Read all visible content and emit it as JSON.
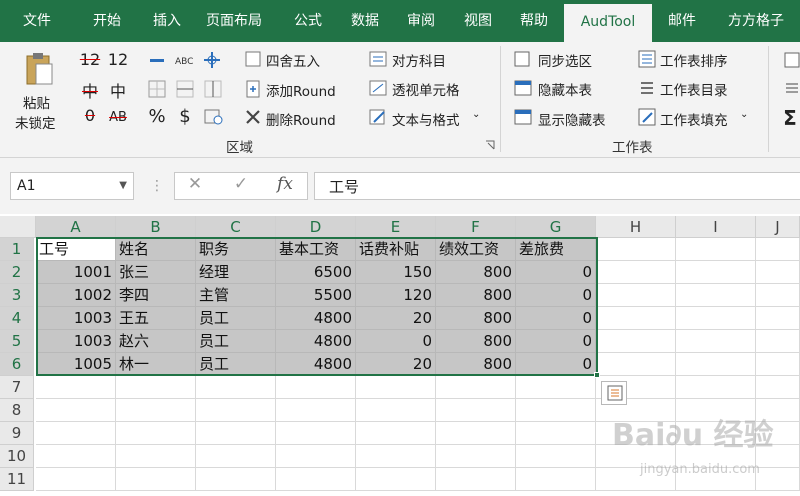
{
  "ribbon_tabs": [
    {
      "label": "文件",
      "active": false
    },
    {
      "label": "开始",
      "active": false
    },
    {
      "label": "插入",
      "active": false
    },
    {
      "label": "页面布局",
      "active": false
    },
    {
      "label": "公式",
      "active": false
    },
    {
      "label": "数据",
      "active": false
    },
    {
      "label": "审阅",
      "active": false
    },
    {
      "label": "视图",
      "active": false
    },
    {
      "label": "帮助",
      "active": false
    },
    {
      "label": "AudTool",
      "active": true
    },
    {
      "label": "邮件",
      "active": false
    },
    {
      "label": "方方格子",
      "active": false
    }
  ],
  "ribbon": {
    "paste_unlocked_line1": "粘贴",
    "paste_unlocked_line2": "未锁定",
    "num_buttons": [
      "12",
      "12",
      "中",
      "中",
      "0",
      "AB"
    ],
    "format_glyphs": {
      "percent": "%",
      "dollar": "$"
    },
    "round_half_up": "四舍五入",
    "add_round": "添加Round",
    "remove_round": "删除Round",
    "group_area": "区域",
    "match_accounts": "对方科目",
    "pivot_cells": "透视单元格",
    "text_and_format": "文本与格式",
    "sync_selection": "同步选区",
    "hide_sheet": "隐藏本表",
    "show_hidden_sheets": "显示隐藏表",
    "sort_sheets": "工作表排序",
    "sheet_index": "工作表目录",
    "fill_sheets": "工作表填充",
    "group_sheet": "工作表",
    "sigma": "Σ"
  },
  "formula_bar": {
    "name_box": "A1",
    "cancel_glyph": "✕",
    "confirm_glyph": "✓",
    "fx": "fx",
    "content": "工号"
  },
  "sheet": {
    "columns": [
      "A",
      "B",
      "C",
      "D",
      "E",
      "F",
      "G",
      "H",
      "I",
      "J"
    ],
    "rows": [
      "1",
      "2",
      "3",
      "4",
      "5",
      "6",
      "7",
      "8",
      "9",
      "10",
      "11"
    ],
    "cells": [
      [
        "工号",
        "姓名",
        "职务",
        "基本工资",
        "话费补贴",
        "绩效工资",
        "差旅费"
      ],
      [
        "1001",
        "张三",
        "经理",
        "6500",
        "150",
        "800",
        "0"
      ],
      [
        "1002",
        "李四",
        "主管",
        "5500",
        "120",
        "800",
        "0"
      ],
      [
        "1003",
        "王五",
        "员工",
        "4800",
        "20",
        "800",
        "0"
      ],
      [
        "1003",
        "赵六",
        "员工",
        "4800",
        "0",
        "800",
        "0"
      ],
      [
        "1005",
        "林一",
        "员工",
        "4800",
        "20",
        "800",
        "0"
      ]
    ]
  },
  "watermark": {
    "brand": "Bai∂u 经验",
    "url": "jingyan.baidu.com"
  }
}
